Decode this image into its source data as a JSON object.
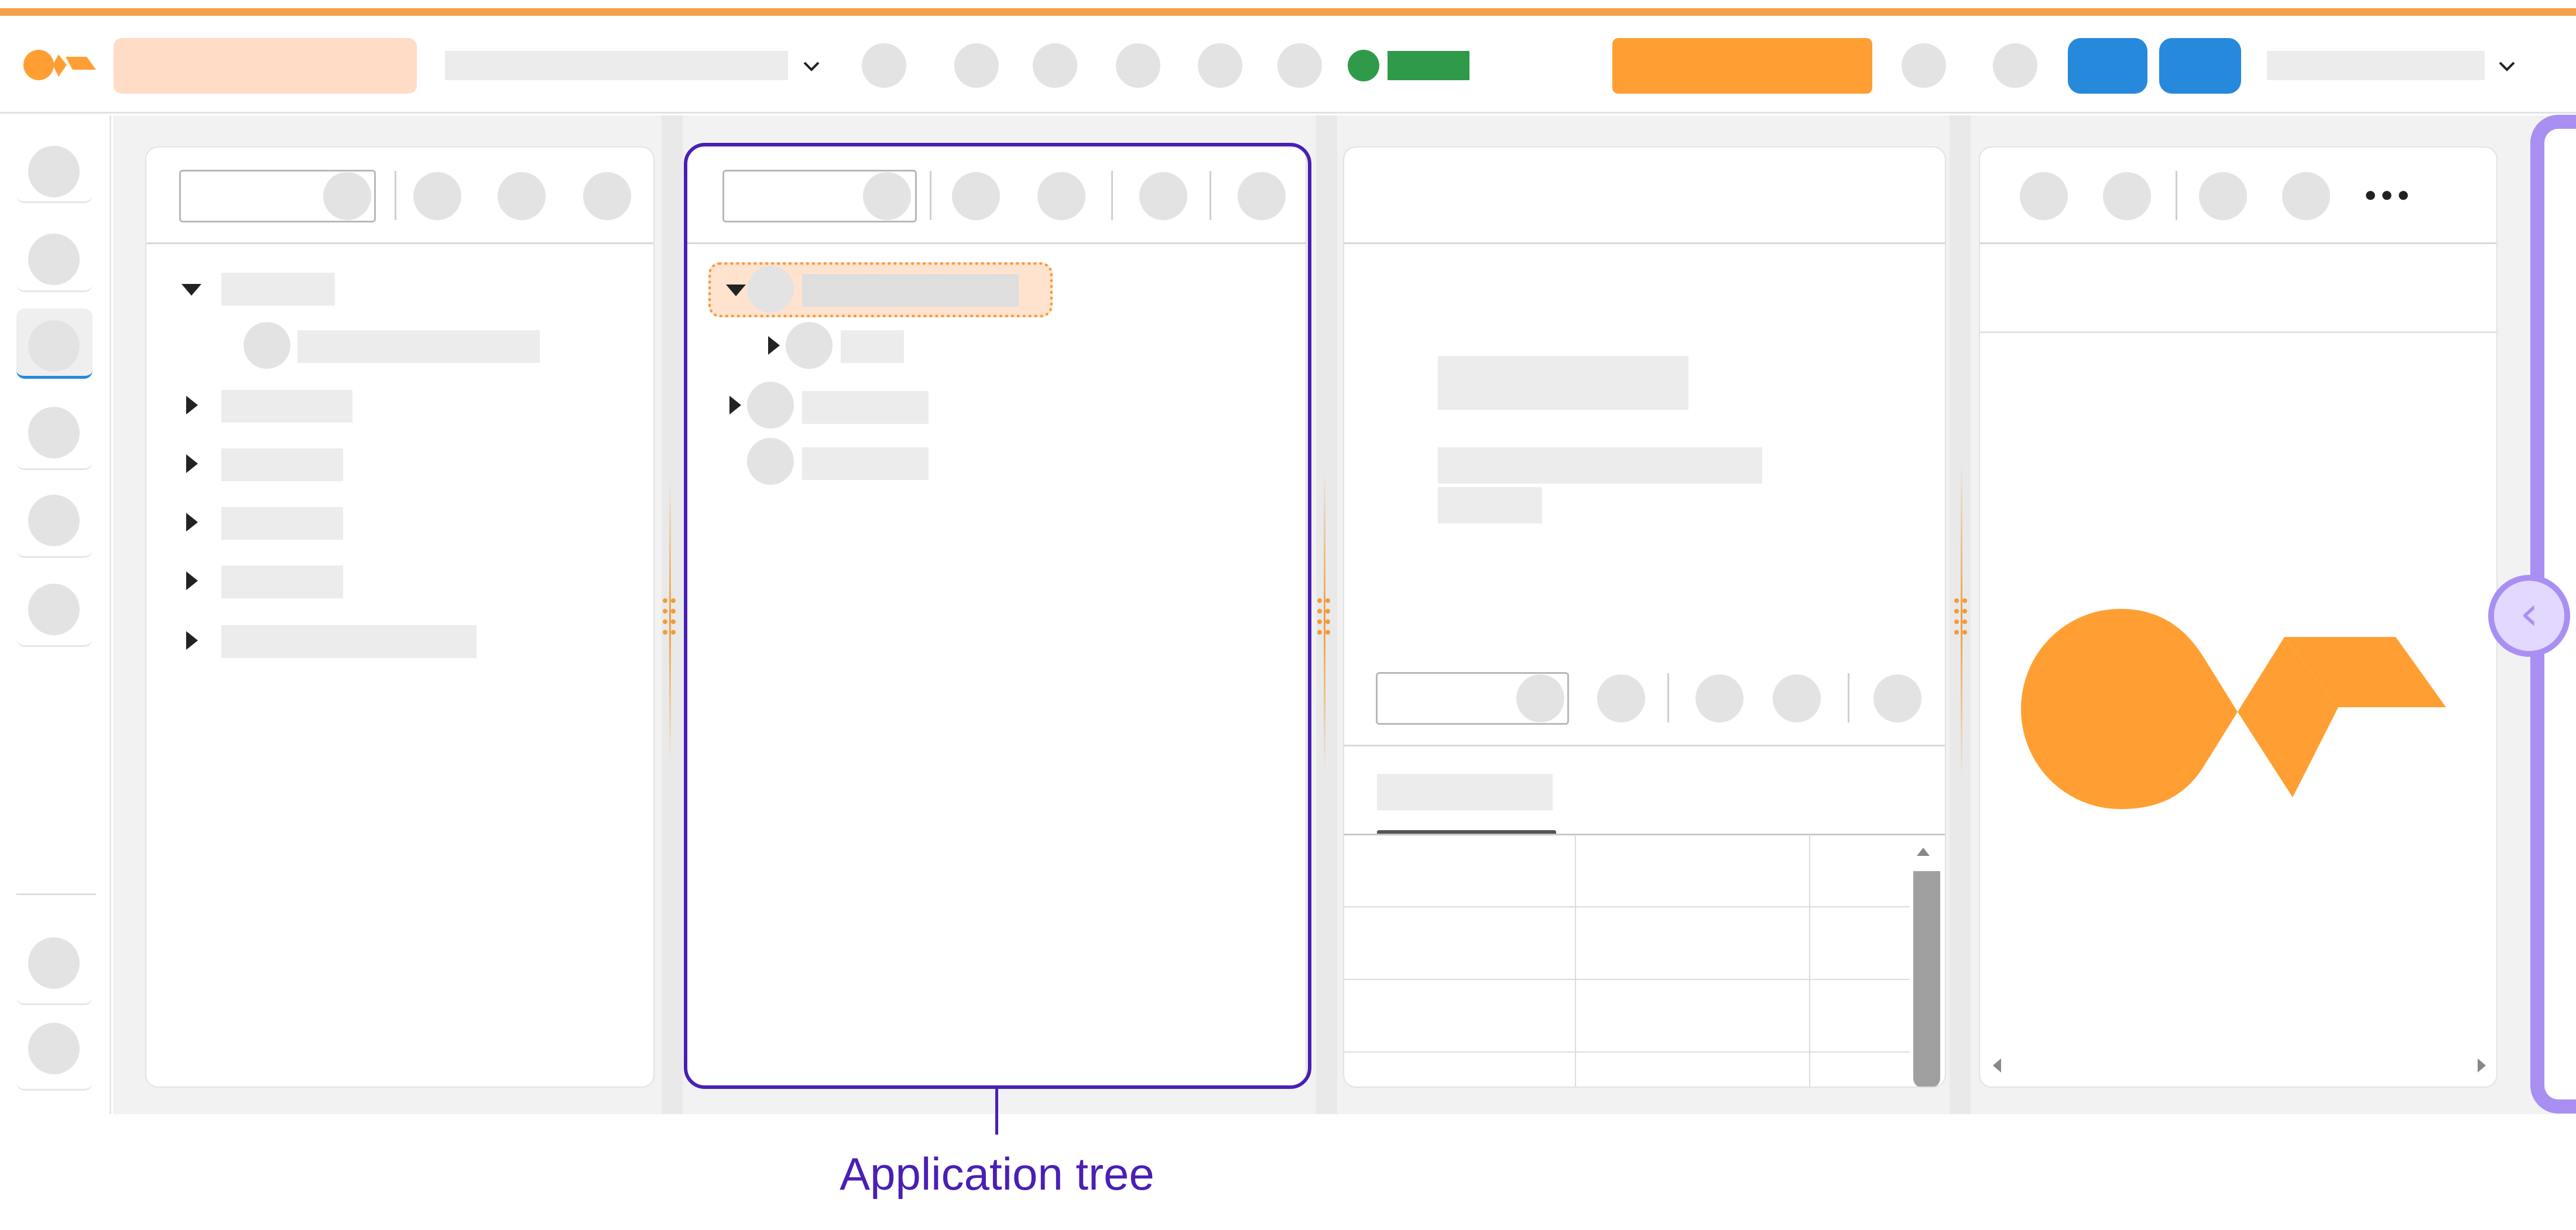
{
  "annotation": {
    "label": "Application tree"
  },
  "colors": {
    "brand_orange": "#ff9f33",
    "accent_purple": "#4a1fb5",
    "light_purple": "#a98ff2",
    "blue": "#2789dc",
    "status_green": "#2f9a4a",
    "peach": "#ffdcc6"
  },
  "icons": {
    "logo": "logo-icon",
    "dropdown": "chevron-down-icon",
    "collapse": "chevron-left-icon",
    "more": "more-horizontal-icon",
    "expand": "triangle-right-icon",
    "collapse_tree": "triangle-down-icon"
  },
  "header": {
    "more_glyph": "•••",
    "collapse_glyph": "‹"
  }
}
